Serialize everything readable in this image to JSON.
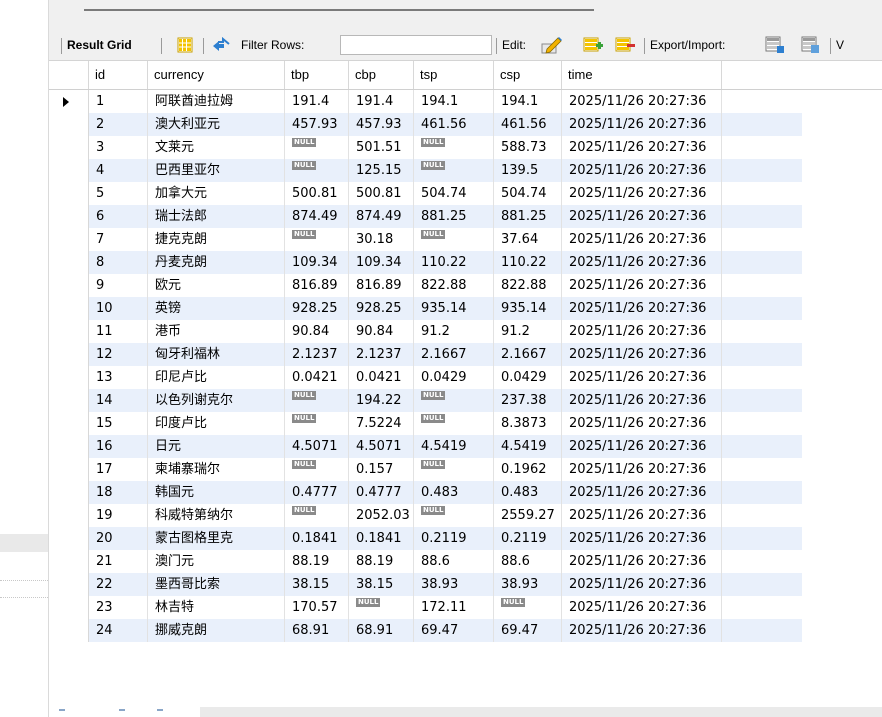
{
  "toolbar": {
    "result_grid_label": "Result Grid",
    "filter_rows_label": "Filter Rows:",
    "filter_value": "",
    "edit_label": "Edit:",
    "export_import_label": "Export/Import:",
    "truncated_label": "V"
  },
  "grid": {
    "columns": [
      "id",
      "currency",
      "tbp",
      "cbp",
      "tsp",
      "csp",
      "time"
    ],
    "null_label": "NULL",
    "rows": [
      {
        "id": "1",
        "currency": "阿联酋迪拉姆",
        "tbp": "191.4",
        "cbp": "191.4",
        "tsp": "194.1",
        "csp": "194.1",
        "time": "2025/11/26 20:27:36"
      },
      {
        "id": "2",
        "currency": "澳大利亚元",
        "tbp": "457.93",
        "cbp": "457.93",
        "tsp": "461.56",
        "csp": "461.56",
        "time": "2025/11/26 20:27:36"
      },
      {
        "id": "3",
        "currency": "文莱元",
        "tbp": null,
        "cbp": "501.51",
        "tsp": null,
        "csp": "588.73",
        "time": "2025/11/26 20:27:36"
      },
      {
        "id": "4",
        "currency": "巴西里亚尔",
        "tbp": null,
        "cbp": "125.15",
        "tsp": null,
        "csp": "139.5",
        "time": "2025/11/26 20:27:36"
      },
      {
        "id": "5",
        "currency": "加拿大元",
        "tbp": "500.81",
        "cbp": "500.81",
        "tsp": "504.74",
        "csp": "504.74",
        "time": "2025/11/26 20:27:36"
      },
      {
        "id": "6",
        "currency": "瑞士法郎",
        "tbp": "874.49",
        "cbp": "874.49",
        "tsp": "881.25",
        "csp": "881.25",
        "time": "2025/11/26 20:27:36"
      },
      {
        "id": "7",
        "currency": "捷克克朗",
        "tbp": null,
        "cbp": "30.18",
        "tsp": null,
        "csp": "37.64",
        "time": "2025/11/26 20:27:36"
      },
      {
        "id": "8",
        "currency": "丹麦克朗",
        "tbp": "109.34",
        "cbp": "109.34",
        "tsp": "110.22",
        "csp": "110.22",
        "time": "2025/11/26 20:27:36"
      },
      {
        "id": "9",
        "currency": "欧元",
        "tbp": "816.89",
        "cbp": "816.89",
        "tsp": "822.88",
        "csp": "822.88",
        "time": "2025/11/26 20:27:36"
      },
      {
        "id": "10",
        "currency": "英镑",
        "tbp": "928.25",
        "cbp": "928.25",
        "tsp": "935.14",
        "csp": "935.14",
        "time": "2025/11/26 20:27:36"
      },
      {
        "id": "11",
        "currency": "港币",
        "tbp": "90.84",
        "cbp": "90.84",
        "tsp": "91.2",
        "csp": "91.2",
        "time": "2025/11/26 20:27:36"
      },
      {
        "id": "12",
        "currency": "匈牙利福林",
        "tbp": "2.1237",
        "cbp": "2.1237",
        "tsp": "2.1667",
        "csp": "2.1667",
        "time": "2025/11/26 20:27:36"
      },
      {
        "id": "13",
        "currency": "印尼卢比",
        "tbp": "0.0421",
        "cbp": "0.0421",
        "tsp": "0.0429",
        "csp": "0.0429",
        "time": "2025/11/26 20:27:36"
      },
      {
        "id": "14",
        "currency": "以色列谢克尔",
        "tbp": null,
        "cbp": "194.22",
        "tsp": null,
        "csp": "237.38",
        "time": "2025/11/26 20:27:36"
      },
      {
        "id": "15",
        "currency": "印度卢比",
        "tbp": null,
        "cbp": "7.5224",
        "tsp": null,
        "csp": "8.3873",
        "time": "2025/11/26 20:27:36"
      },
      {
        "id": "16",
        "currency": "日元",
        "tbp": "4.5071",
        "cbp": "4.5071",
        "tsp": "4.5419",
        "csp": "4.5419",
        "time": "2025/11/26 20:27:36"
      },
      {
        "id": "17",
        "currency": "柬埔寨瑞尔",
        "tbp": null,
        "cbp": "0.157",
        "tsp": null,
        "csp": "0.1962",
        "time": "2025/11/26 20:27:36"
      },
      {
        "id": "18",
        "currency": "韩国元",
        "tbp": "0.4777",
        "cbp": "0.4777",
        "tsp": "0.483",
        "csp": "0.483",
        "time": "2025/11/26 20:27:36"
      },
      {
        "id": "19",
        "currency": "科威特第纳尔",
        "tbp": null,
        "cbp": "2052.03",
        "tsp": null,
        "csp": "2559.27",
        "time": "2025/11/26 20:27:36"
      },
      {
        "id": "20",
        "currency": "蒙古图格里克",
        "tbp": "0.1841",
        "cbp": "0.1841",
        "tsp": "0.2119",
        "csp": "0.2119",
        "time": "2025/11/26 20:27:36"
      },
      {
        "id": "21",
        "currency": "澳门元",
        "tbp": "88.19",
        "cbp": "88.19",
        "tsp": "88.6",
        "csp": "88.6",
        "time": "2025/11/26 20:27:36"
      },
      {
        "id": "22",
        "currency": "墨西哥比索",
        "tbp": "38.15",
        "cbp": "38.15",
        "tsp": "38.93",
        "csp": "38.93",
        "time": "2025/11/26 20:27:36"
      },
      {
        "id": "23",
        "currency": "林吉特",
        "tbp": "170.57",
        "cbp": null,
        "tsp": "172.11",
        "csp": null,
        "time": "2025/11/26 20:27:36"
      },
      {
        "id": "24",
        "currency": "挪威克朗",
        "tbp": "68.91",
        "cbp": "68.91",
        "tsp": "69.47",
        "csp": "69.47",
        "time": "2025/11/26 20:27:36"
      }
    ]
  },
  "colors": {
    "toolbar_bg": "#f0f0f0",
    "row_alt_bg": "#e9f0fb",
    "null_badge_bg": "#8a8a8a"
  },
  "icons": {
    "grid_view": "grid-icon",
    "refresh": "refresh-arrows-icon",
    "edit_row": "edit-pencil-icon",
    "add_row": "add-row-icon",
    "delete_row": "delete-row-icon",
    "export": "export-icon",
    "import": "import-icon"
  }
}
